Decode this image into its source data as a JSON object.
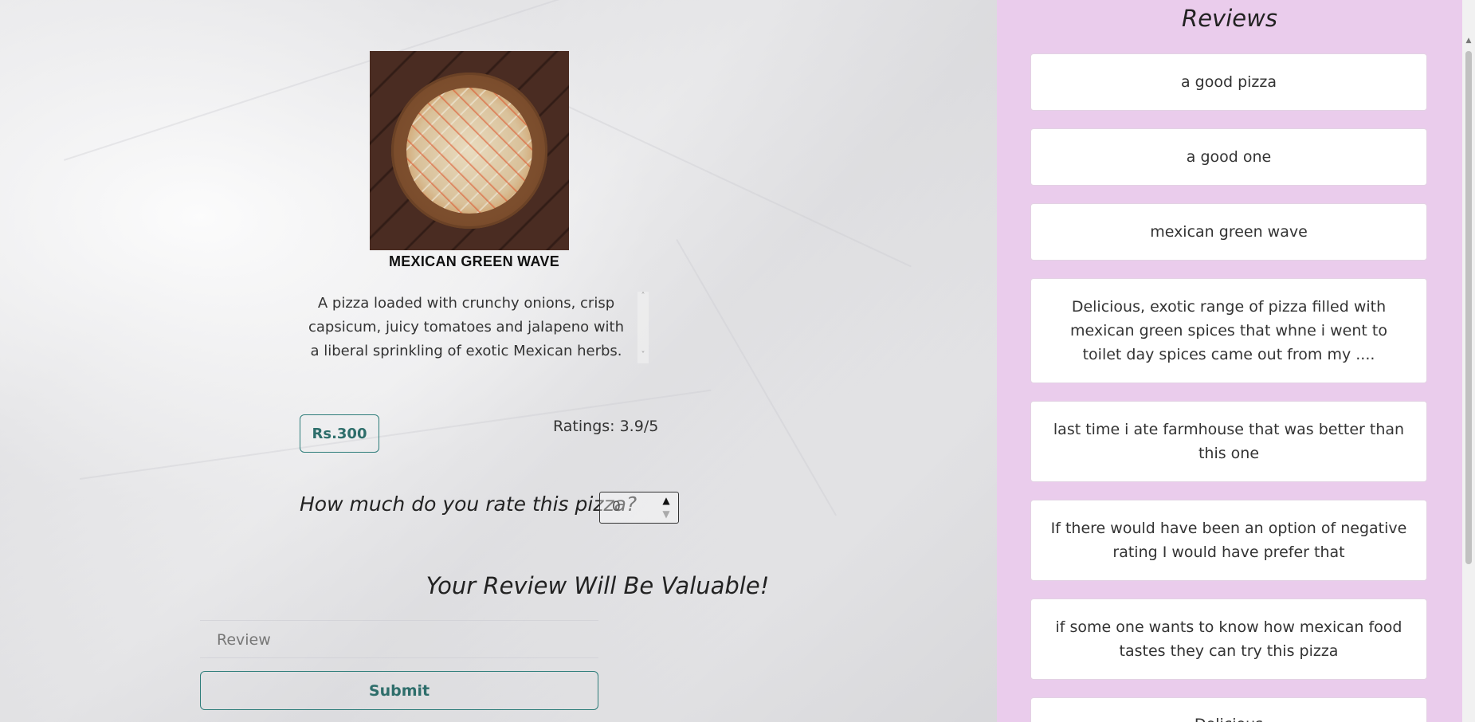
{
  "product": {
    "name": "MEXICAN GREEN WAVE",
    "description": "A pizza loaded with crunchy onions, crisp capsicum, juicy tomatoes and jalapeno with a liberal sprinkling of exotic Mexican herbs.",
    "price_label": "Rs.300",
    "ratings_label": "Ratings: 3.9/5"
  },
  "rating_form": {
    "question": "How much do you rate this pizza?",
    "value": "0"
  },
  "review_form": {
    "heading": "Your Review Will Be Valuable!",
    "placeholder": "Review",
    "submit_label": "Submit"
  },
  "reviews": {
    "title": "Reviews",
    "items": [
      "a good pizza",
      "a good one",
      "mexican green wave",
      "Delicious, exotic range of pizza filled with mexican green spices that whne i went to toilet day spices came out from my ....",
      "last time i ate farmhouse that was better than this one",
      "If there would have been an option of negative rating I would have prefer that",
      "if some one wants to know how mexican food tastes they can try this pizza",
      "Delicious"
    ]
  },
  "icons": {
    "spin_up": "▲",
    "spin_down": "▼",
    "scroll_up": "˄",
    "scroll_down": "˅"
  }
}
